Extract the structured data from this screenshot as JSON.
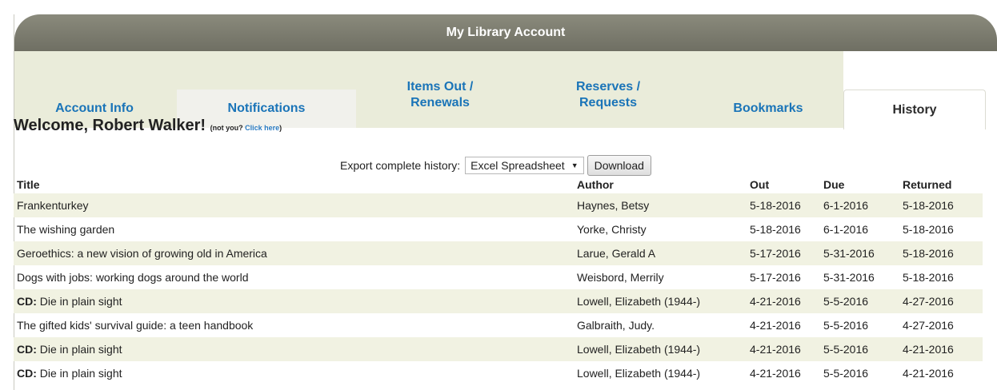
{
  "header": {
    "title": "My Library Account"
  },
  "tabs": [
    {
      "line1": "Account Info",
      "line2": ""
    },
    {
      "line1": "Notifications",
      "line2": ""
    },
    {
      "line1": "Items Out /",
      "line2": "Renewals"
    },
    {
      "line1": "Reserves /",
      "line2": "Requests"
    },
    {
      "line1": "Bookmarks",
      "line2": ""
    },
    {
      "line1": "History",
      "line2": ""
    }
  ],
  "welcome": {
    "greeting": "Welcome, Robert Walker!",
    "not_you": "(not you?",
    "click_here": "Click here",
    "close_paren": ")"
  },
  "export": {
    "label": "Export complete history:",
    "selected_format": "Excel Spreadsheet",
    "download_label": "Download"
  },
  "table": {
    "headers": [
      "Title",
      "Author",
      "Out",
      "Due",
      "Returned"
    ],
    "rows": [
      {
        "format": "",
        "title": "Frankenturkey",
        "author": "Haynes, Betsy",
        "out": "5-18-2016",
        "due": "6-1-2016",
        "returned": "5-18-2016"
      },
      {
        "format": "",
        "title": "The wishing garden",
        "author": "Yorke, Christy",
        "out": "5-18-2016",
        "due": "6-1-2016",
        "returned": "5-18-2016"
      },
      {
        "format": "",
        "title": "Geroethics: a new vision of growing old in America",
        "author": "Larue, Gerald A",
        "out": "5-17-2016",
        "due": "5-31-2016",
        "returned": "5-18-2016"
      },
      {
        "format": "",
        "title": "Dogs with jobs: working dogs around the world",
        "author": "Weisbord, Merrily",
        "out": "5-17-2016",
        "due": "5-31-2016",
        "returned": "5-18-2016"
      },
      {
        "format": "CD:",
        "title": "Die in plain sight",
        "author": "Lowell, Elizabeth (1944-)",
        "out": "4-21-2016",
        "due": "5-5-2016",
        "returned": "4-27-2016"
      },
      {
        "format": "",
        "title": "The gifted kids' survival guide: a teen handbook",
        "author": "Galbraith, Judy.",
        "out": "4-21-2016",
        "due": "5-5-2016",
        "returned": "4-27-2016"
      },
      {
        "format": "CD:",
        "title": "Die in plain sight",
        "author": "Lowell, Elizabeth (1944-)",
        "out": "4-21-2016",
        "due": "5-5-2016",
        "returned": "4-21-2016"
      },
      {
        "format": "CD:",
        "title": "Die in plain sight",
        "author": "Lowell, Elizabeth (1944-)",
        "out": "4-21-2016",
        "due": "5-5-2016",
        "returned": "4-21-2016"
      }
    ]
  }
}
